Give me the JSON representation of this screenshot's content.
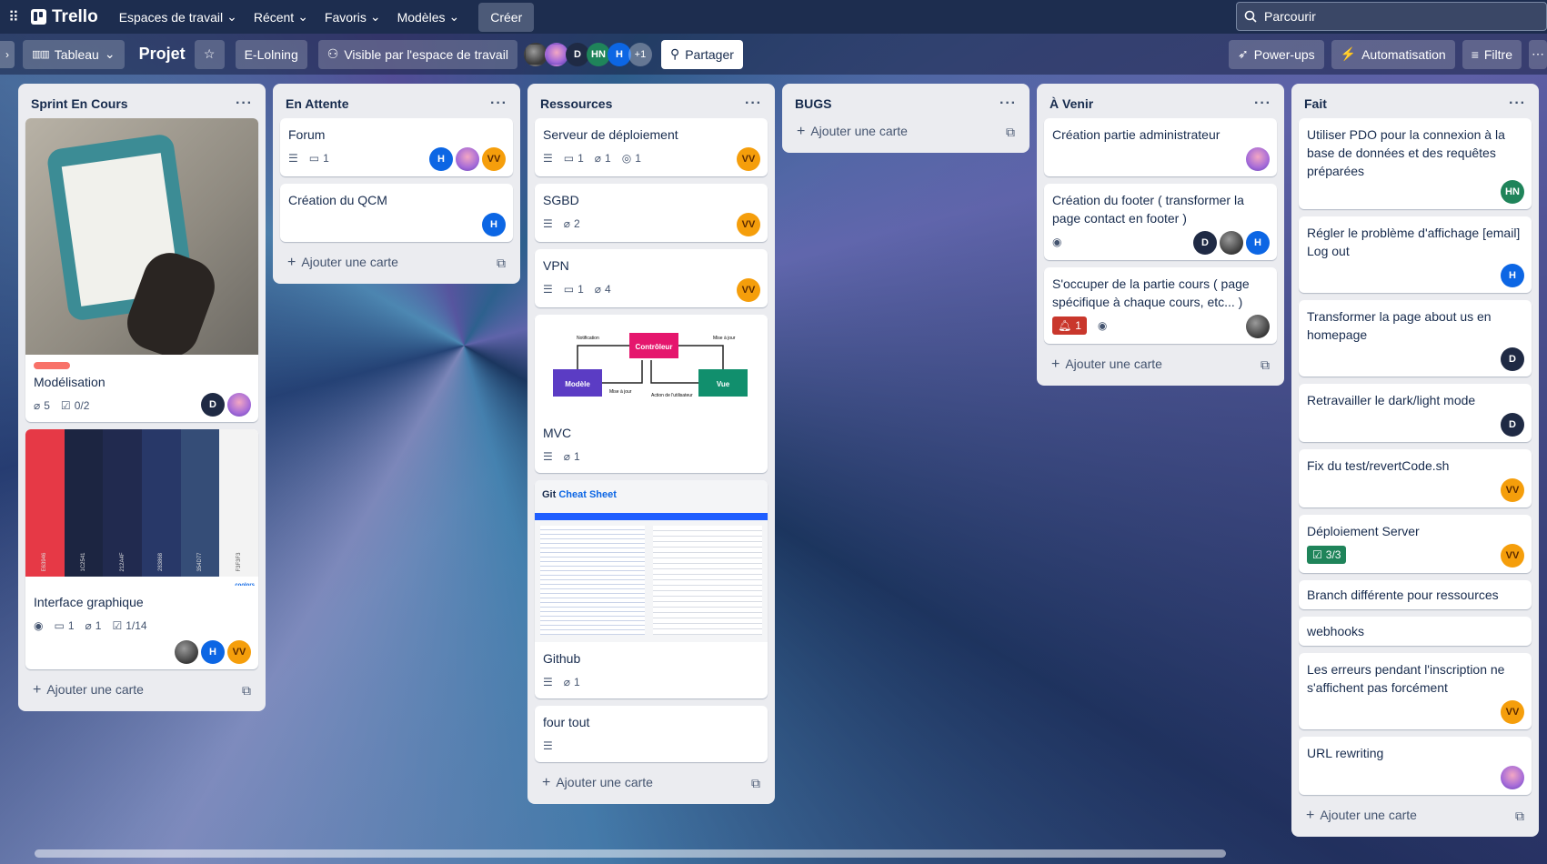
{
  "topbar": {
    "app_name": "Trello",
    "nav": [
      "Espaces de travail",
      "Récent",
      "Favoris",
      "Modèles"
    ],
    "create": "Créer",
    "search_placeholder": "Parcourir"
  },
  "boardbar": {
    "view": "Tableau",
    "title": "Projet",
    "workspace": "E-Lolning",
    "visibility": "Visible par l'espace de travail",
    "members": [
      "D",
      "HN",
      "H"
    ],
    "extra_members": "+1",
    "share": "Partager",
    "powerups": "Power-ups",
    "automation": "Automatisation",
    "filter": "Filtre"
  },
  "add_card": "Ajouter une carte",
  "lists": [
    {
      "title": "Sprint En Cours",
      "cards": [
        {
          "title": "Modélisation",
          "attachments": "5",
          "checklist": "0/2",
          "members": [
            "D",
            "photo-purple"
          ]
        },
        {
          "title": "Interface graphique",
          "comments": "1",
          "attachments": "1",
          "checklist": "1/14",
          "members": [
            "photo",
            "H",
            "VV"
          ],
          "palette": [
            "#E63946",
            "#1C2541",
            "#212A4F",
            "#283868",
            "#354D77",
            "#F3F3F3"
          ],
          "palette_codes": [
            "E63946",
            "1C2541",
            "212A4F",
            "283868",
            "354D77",
            "F3F3F3"
          ],
          "palette_brand": "coolors"
        }
      ]
    },
    {
      "title": "En Attente",
      "cards": [
        {
          "title": "Forum",
          "comments": "1",
          "members": [
            "H",
            "purple",
            "VV"
          ]
        },
        {
          "title": "Création du QCM",
          "members": [
            "H"
          ]
        }
      ]
    },
    {
      "title": "Ressources",
      "cards": [
        {
          "title": "Serveur de déploiement",
          "comments": "1",
          "attachments": "1",
          "github": "1",
          "members": [
            "VV"
          ]
        },
        {
          "title": "SGBD",
          "attachments": "2",
          "members": [
            "VV"
          ]
        },
        {
          "title": "VPN",
          "comments": "1",
          "attachments": "4",
          "members": [
            "VV"
          ]
        },
        {
          "title": "MVC",
          "attachments": "1",
          "diagram": {
            "controller": "Contrôleur",
            "model": "Modèle",
            "view": "Vue",
            "notification": "Notification",
            "update_top": "Mise à jour",
            "update_bottom": "Mise à jour",
            "user_action": "Action de l'utilisateur"
          }
        },
        {
          "title": "Github",
          "attachments": "1",
          "cheatsheet_title_a": "Git",
          "cheatsheet_title_b": "Cheat Sheet"
        },
        {
          "title": "four tout"
        }
      ]
    },
    {
      "title": "BUGS",
      "cards": []
    },
    {
      "title": "À Venir",
      "cards": [
        {
          "title": "Création partie administrateur",
          "members": [
            "purple"
          ]
        },
        {
          "title": "Création du footer ( transformer la page contact en footer )",
          "members": [
            "D",
            "photo",
            "H"
          ]
        },
        {
          "title": "S'occuper de la partie cours ( page spécifique à chaque cours, etc... )",
          "notif": "1",
          "members": [
            "photo"
          ]
        }
      ]
    },
    {
      "title": "Fait",
      "cards": [
        {
          "title": "Utiliser PDO pour la connexion à la base de données et des requêtes préparées",
          "members": [
            "HN"
          ]
        },
        {
          "title": "Régler le problème d'affichage [email] Log out",
          "members": [
            "H"
          ]
        },
        {
          "title": "Transformer la page about us en homepage",
          "members": [
            "D"
          ]
        },
        {
          "title": "Retravailler le dark/light mode",
          "members": [
            "D"
          ]
        },
        {
          "title": "Fix du test/revertCode.sh",
          "members": [
            "VV"
          ]
        },
        {
          "title": "Déploiement Server",
          "checklist": "3/3",
          "members": [
            "VV"
          ]
        },
        {
          "title": "Branch différente pour ressources"
        },
        {
          "title": "webhooks"
        },
        {
          "title": "Les erreurs pendant l'inscription ne s'affichent pas forcément",
          "members": [
            "VV"
          ]
        },
        {
          "title": "URL rewriting",
          "members": [
            "purple"
          ]
        }
      ]
    }
  ],
  "icons": {
    "apps": "grid-icon",
    "search": "search-icon",
    "star": "star-icon",
    "eye": "eye-icon",
    "comment": "comment-icon",
    "attachment": "paperclip-icon",
    "checklist": "checklist-icon",
    "description": "lines-icon",
    "github": "github-icon",
    "bell": "bell-icon"
  },
  "colors": {
    "topbar": "#1d2d4f",
    "list": "#ebecf0",
    "label_red": "#f87168",
    "member_blue": "#0c66e4",
    "member_orange": "#f59e0b",
    "member_green": "#1f845a",
    "complete_green": "#1f845a"
  }
}
